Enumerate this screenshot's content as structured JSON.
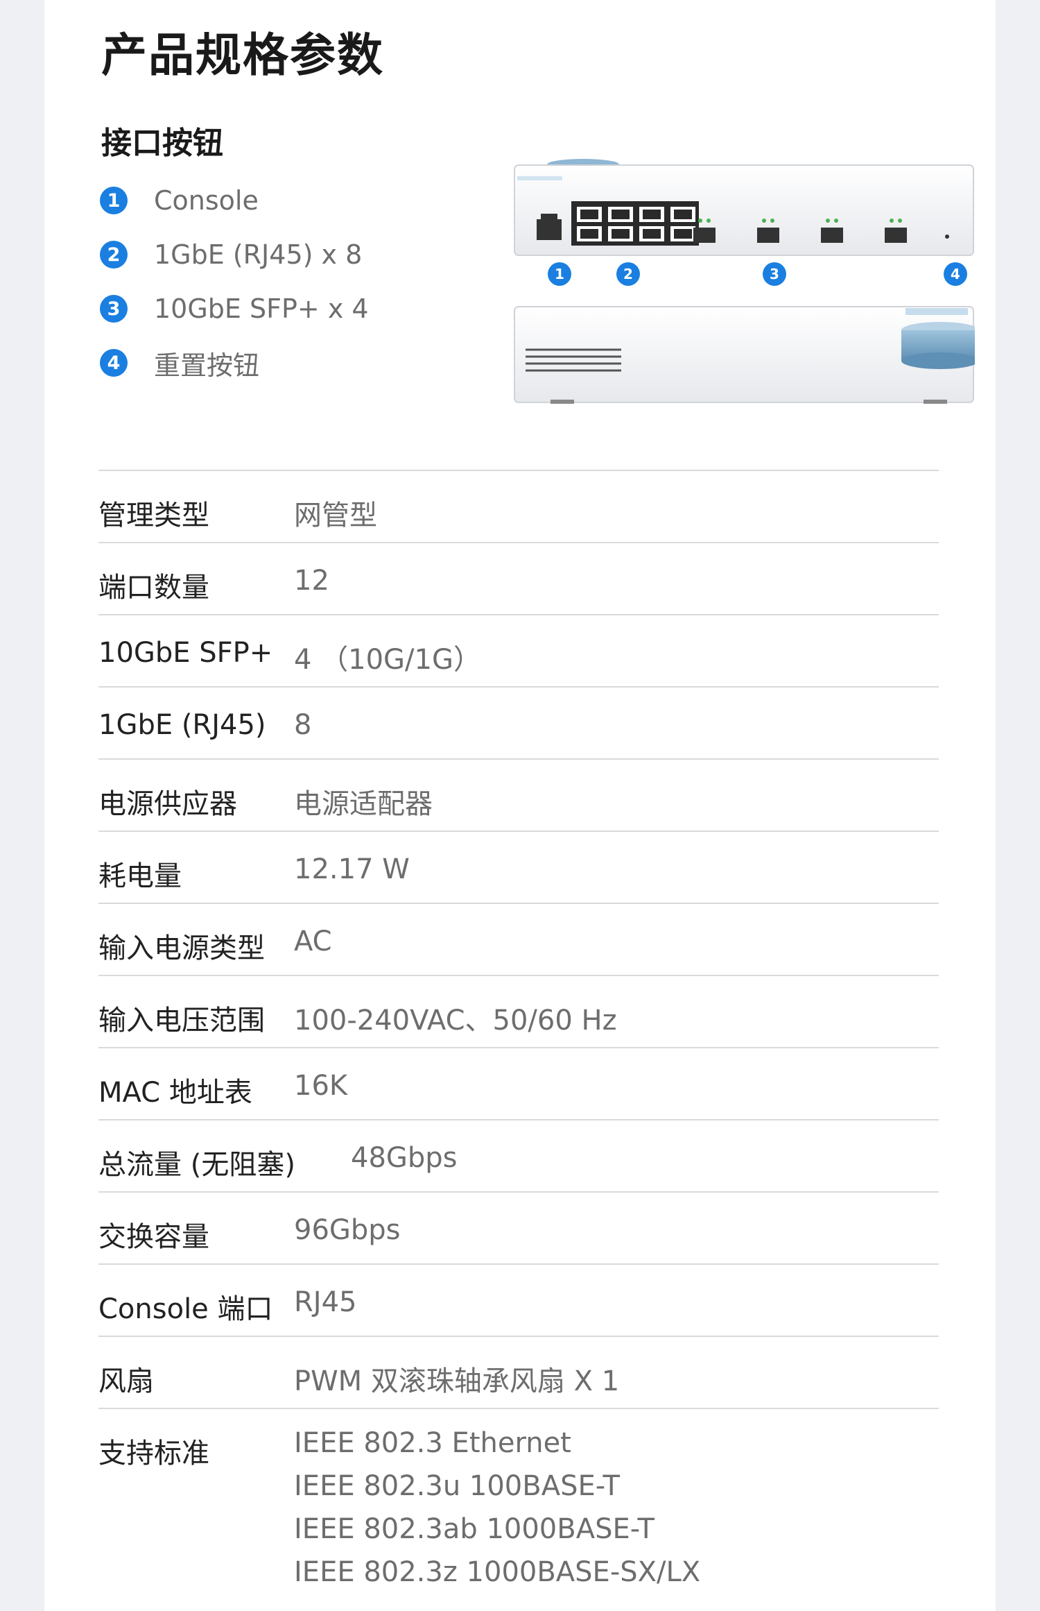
{
  "page_title": "产品规格参数",
  "interfaces": {
    "title": "接口按钮",
    "items": [
      {
        "num": "1",
        "label": "Console"
      },
      {
        "num": "2",
        "label": "1GbE (RJ45) x 8"
      },
      {
        "num": "3",
        "label": "10GbE SFP+ x 4"
      },
      {
        "num": "4",
        "label": "重置按钮"
      }
    ]
  },
  "specs": [
    {
      "key": "管理类型",
      "value": "网管型"
    },
    {
      "key": "端口数量",
      "value": "12"
    },
    {
      "key": "10GbE SFP+",
      "value": "4 （10G/1G）"
    },
    {
      "key": "1GbE (RJ45)",
      "value": "8"
    },
    {
      "key": "电源供应器",
      "value": "电源适配器"
    },
    {
      "key": "耗电量",
      "value": "12.17 W"
    },
    {
      "key": "输入电源类型",
      "value": "AC"
    },
    {
      "key": "输入电压范围",
      "value": "100-240VAC、50/60 Hz"
    },
    {
      "key": "MAC 地址表",
      "value": "16K"
    },
    {
      "key": "总流量 (无阻塞)",
      "value": "48Gbps"
    },
    {
      "key": "交换容量",
      "value": "96Gbps"
    },
    {
      "key": "Console 端口",
      "value": "RJ45"
    },
    {
      "key": "风扇",
      "value": "PWM 双滚珠轴承风扇 X 1"
    }
  ],
  "standards": {
    "key": "支持标准",
    "values": [
      "IEEE 802.3 Ethernet",
      "IEEE 802.3u 100BASE-T",
      "IEEE 802.3ab 1000BASE-T",
      "IEEE 802.3z 1000BASE-SX/LX"
    ]
  },
  "colors": {
    "accent": "#1a7fe0",
    "divider": "#dadada",
    "label_text": "#222222",
    "value_text": "#6d6d6d"
  }
}
